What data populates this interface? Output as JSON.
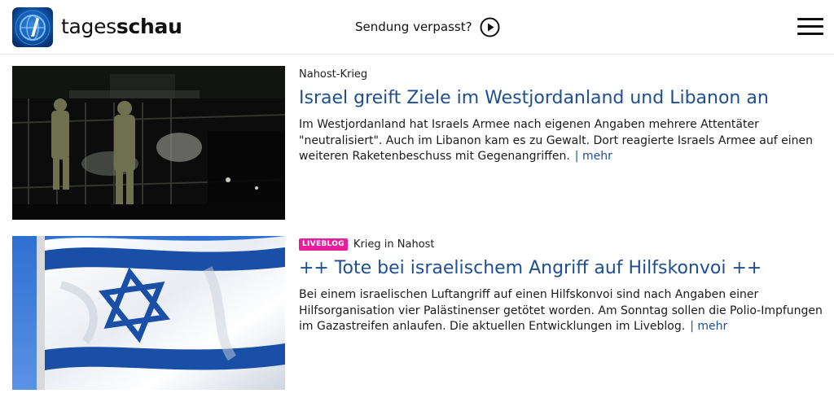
{
  "header": {
    "logo_text_light": "tages",
    "logo_text_bold": "schau",
    "missed_label": "Sendung verpasst?"
  },
  "teasers": [
    {
      "topline": "Nahost-Krieg",
      "headline": "Israel greift Ziele im Westjordanland und Libanon an",
      "text": "Im Westjordanland hat Israels Armee nach eigenen Angaben mehrere Attentäter \"neutralisiert\". Auch im Libanon kam es zu Gewalt. Dort reagierte Israels Armee auf einen weiteren Raketenbeschuss mit Gegenangriffen.",
      "more": "| mehr"
    },
    {
      "badge": "LIVEBLOG",
      "topline": "Krieg in Nahost",
      "headline": "++ Tote bei israelischem Angriff auf Hilfskonvoi ++",
      "text": "Bei einem israelischen Luftangriff auf einen Hilfskonvoi sind nach Angaben einer Hilfsorganisation vier Palästinenser getötet worden. Am Sonntag sollen die Polio-Impfungen im Gazastreifen anlaufen. Die aktuellen Entwicklungen im Liveblog.",
      "more": "| mehr"
    }
  ],
  "colors": {
    "link": "#1d4f91",
    "badge": "#e51f9e",
    "logo_blue": "#0a3d8f"
  },
  "icons": [
    "tagesschau-logo-icon",
    "play-circle-icon",
    "hamburger-menu-icon"
  ]
}
